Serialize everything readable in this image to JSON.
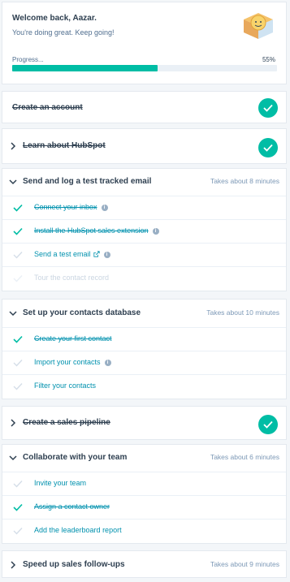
{
  "header": {
    "title": "Welcome back, Aazar.",
    "subtitle": "You're doing great. Keep going!",
    "progress_label": "Progress...",
    "progress_value": "55%",
    "progress_fraction": 0.55
  },
  "sections": {
    "s1": {
      "title": "Create an account",
      "completed": true
    },
    "s2": {
      "title": "Learn about HubSpot",
      "completed": true
    },
    "s3": {
      "title": "Send and log a test tracked email",
      "time": "Takes about 8 minutes",
      "items": [
        {
          "label": "Connect your inbox",
          "done": true
        },
        {
          "label": "Install the HubSpot sales extension",
          "done": true
        },
        {
          "label": "Send a test email",
          "done": false
        },
        {
          "label": "Tour the contact record",
          "done": false
        }
      ]
    },
    "s4": {
      "title": "Set up your contacts database",
      "time": "Takes about 10 minutes",
      "items": [
        {
          "label": "Create your first contact",
          "done": true
        },
        {
          "label": "Import your contacts",
          "done": false
        },
        {
          "label": "Filter your contacts",
          "done": false
        }
      ]
    },
    "s5": {
      "title": "Create a sales pipeline",
      "completed": true
    },
    "s6": {
      "title": "Collaborate with your team",
      "time": "Takes about 6 minutes",
      "items": [
        {
          "label": "Invite your team",
          "done": false
        },
        {
          "label": "Assign a contact owner",
          "done": true
        },
        {
          "label": "Add the leaderboard report",
          "done": false
        }
      ]
    },
    "s7": {
      "title": "Speed up sales follow-ups",
      "time": "Takes about 9 minutes"
    }
  },
  "colors": {
    "teal": "#00bda5",
    "link": "#0091ae",
    "muted": "#cbd6e2"
  },
  "icons": [
    "badge-icon",
    "chevron-right-icon",
    "chevron-down-icon",
    "check-icon",
    "info-icon",
    "external-link-icon"
  ]
}
